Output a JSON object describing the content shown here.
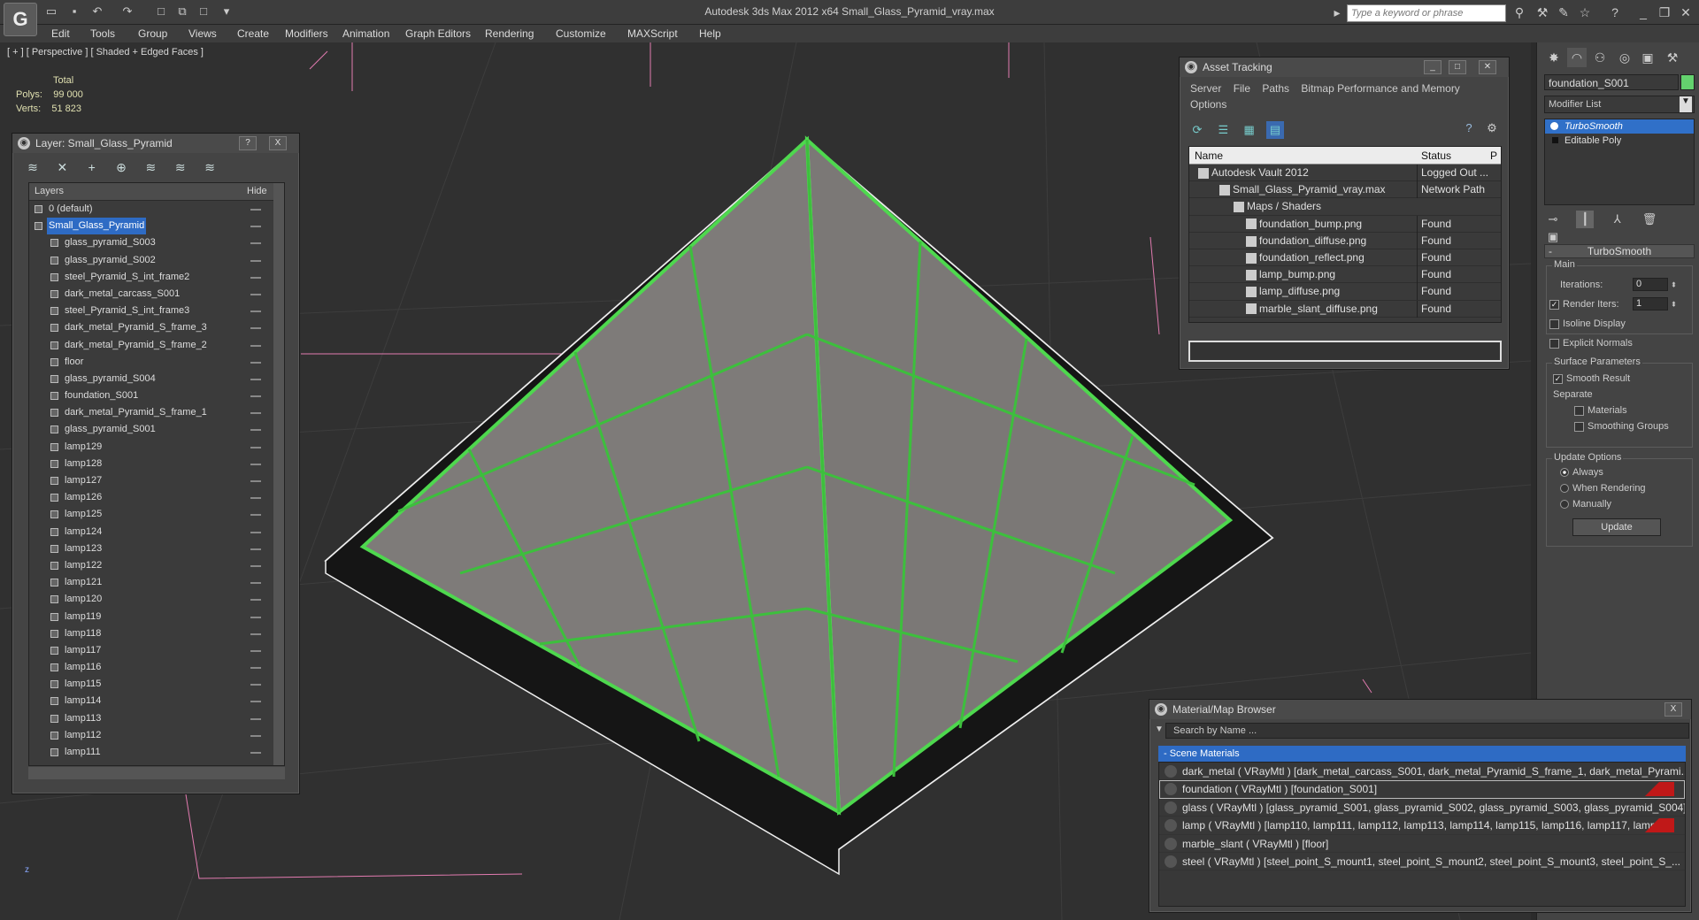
{
  "window": {
    "logo_text": "G",
    "title": "Autodesk 3ds Max  2012 x64     Small_Glass_Pyramid_vray.max",
    "search_placeholder": "Type a keyword or phrase"
  },
  "menus": [
    "Edit",
    "Tools",
    "Group",
    "Views",
    "Create",
    "Modifiers",
    "Animation",
    "Graph Editors",
    "Rendering",
    "Customize",
    "MAXScript",
    "Help"
  ],
  "viewport": {
    "label": "[ + ] [ Perspective ] [ Shaded + Edged Faces ]",
    "stats_total": "Total",
    "polys_label": "Polys:",
    "polys_value": "99 000",
    "verts_label": "Verts:",
    "verts_value": "51 823",
    "axis_z": "z",
    "colors": {
      "wire": "#4ed84e",
      "grid": "#3c3c3c",
      "axis": "#e27bb0",
      "base": "#222222"
    }
  },
  "layer_panel": {
    "title": "Layer: Small_Glass_Pyramid",
    "help_btn": "?",
    "close_btn": "X",
    "col_layers": "Layers",
    "col_hide": "Hide",
    "layers": [
      "0 (default)",
      "Small_Glass_Pyramid",
      "glass_pyramid_S003",
      "glass_pyramid_S002",
      "steel_Pyramid_S_int_frame2",
      "dark_metal_carcass_S001",
      "steel_Pyramid_S_int_frame3",
      "dark_metal_Pyramid_S_frame_3",
      "dark_metal_Pyramid_S_frame_2",
      "floor",
      "glass_pyramid_S004",
      "foundation_S001",
      "dark_metal_Pyramid_S_frame_1",
      "glass_pyramid_S001",
      "lamp129",
      "lamp128",
      "lamp127",
      "lamp126",
      "lamp125",
      "lamp124",
      "lamp123",
      "lamp122",
      "lamp121",
      "lamp120",
      "lamp119",
      "lamp118",
      "lamp117",
      "lamp116",
      "lamp115",
      "lamp114",
      "lamp113",
      "lamp112",
      "lamp111"
    ],
    "selected_index": 1
  },
  "asset_panel": {
    "title": "Asset Tracking",
    "menu": [
      "Server",
      "File",
      "Paths",
      "Bitmap Performance and Memory",
      "Options"
    ],
    "col_name": "Name",
    "col_status": "Status",
    "col_extra": "P",
    "rows": [
      {
        "name": "Autodesk Vault 2012",
        "status": "Logged Out ..."
      },
      {
        "name": "Small_Glass_Pyramid_vray.max",
        "status": "Network Path"
      },
      {
        "name": "Maps / Shaders",
        "status": ""
      },
      {
        "name": "foundation_bump.png",
        "status": "Found"
      },
      {
        "name": "foundation_diffuse.png",
        "status": "Found"
      },
      {
        "name": "foundation_reflect.png",
        "status": "Found"
      },
      {
        "name": "lamp_bump.png",
        "status": "Found"
      },
      {
        "name": "lamp_diffuse.png",
        "status": "Found"
      },
      {
        "name": "marble_slant_diffuse.png",
        "status": "Found"
      }
    ]
  },
  "command_panel": {
    "object_name": "foundation_S001",
    "object_color": "#64d26e",
    "modifier_list": "Modifier List",
    "stack": [
      "TurboSmooth",
      "Editable Poly"
    ],
    "rollout_title": "TurboSmooth",
    "main_label": "Main",
    "iterations_label": "Iterations:",
    "iterations_value": "0",
    "render_iters_label": "Render Iters:",
    "render_iters_value": "1",
    "render_iters_checked": true,
    "isoline_label": "Isoline Display",
    "explicit_normals_label": "Explicit Normals",
    "surface_label": "Surface Parameters",
    "smooth_result_label": "Smooth Result",
    "separate_label": "Separate",
    "materials_label": "Materials",
    "smoothing_groups_label": "Smoothing Groups",
    "update_options_label": "Update Options",
    "always_label": "Always",
    "when_rendering_label": "When Rendering",
    "manually_label": "Manually",
    "update_button": "Update"
  },
  "material_panel": {
    "title": "Material/Map Browser",
    "close_btn": "X",
    "search_placeholder": "Search by Name ...",
    "section": "- Scene Materials",
    "materials": [
      "dark_metal  ( VRayMtl ) [dark_metal_carcass_S001, dark_metal_Pyramid_S_frame_1, dark_metal_Pyrami...",
      "foundation  ( VRayMtl ) [foundation_S001]",
      "glass  ( VRayMtl ) [glass_pyramid_S001, glass_pyramid_S002, glass_pyramid_S003, glass_pyramid_S004]",
      "lamp  ( VRayMtl )  [lamp110, lamp111, lamp112, lamp113, lamp114, lamp115, lamp116, lamp117, lamp1...",
      "marble_slant  ( VRayMtl ) [floor]",
      "steel  ( VRayMtl ) [steel_point_S_mount1, steel_point_S_mount2, steel_point_S_mount3, steel_point_S_..."
    ]
  }
}
